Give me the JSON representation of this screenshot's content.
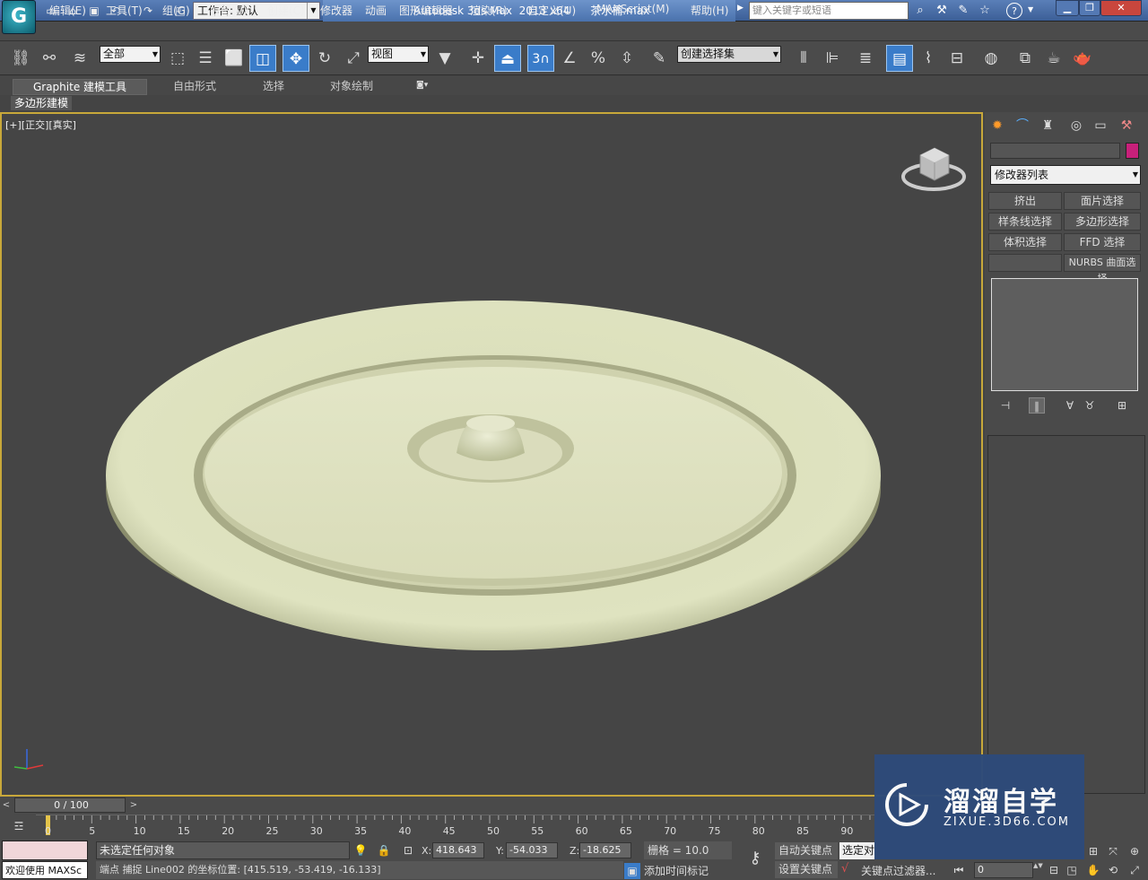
{
  "app": {
    "logo": "G",
    "title": "Autodesk 3ds Max  2013 x64      茶水桶.max",
    "workspace": "工作台: 默认",
    "search_placeholder": "键入关键字或短语"
  },
  "menu": [
    "编辑(E)",
    "工具(T)",
    "组(G)",
    "视图(V)",
    "创建(C)",
    "修改器",
    "动画",
    "图形编辑器",
    "渲染(R)",
    "自定义(U)",
    "MAXScript(M)",
    "帮助(H)"
  ],
  "toolbar": {
    "filter": "全部",
    "refcoord": "视图",
    "snap_value": "3",
    "selset": "创建选择集"
  },
  "ribbon": {
    "tabs": [
      "Graphite 建模工具",
      "自由形式",
      "选择",
      "对象绘制"
    ],
    "sub": "多边形建模"
  },
  "viewport": {
    "label": "[+][正交][真实]",
    "model": "lid"
  },
  "panel": {
    "tabs_icons": [
      "sun-icon",
      "curve-icon",
      "hierarchy-icon",
      "motion-icon",
      "display-icon",
      "hammer-icon"
    ],
    "swatch_color": "#c8207a",
    "modlist": "修改器列表",
    "buttons": [
      "挤出",
      "面片选择",
      "样条线选择",
      "多边形选择",
      "体积选择",
      "FFD 选择",
      "",
      "NURBS 曲面选择"
    ]
  },
  "timeline": {
    "counter": "0 / 100",
    "ticks": [
      "0",
      "5",
      "10",
      "15",
      "20",
      "25",
      "30",
      "35",
      "40",
      "45",
      "50",
      "55",
      "60",
      "65",
      "70",
      "75",
      "80",
      "85",
      "90"
    ]
  },
  "status": {
    "maxscript": "欢迎使用  MAXSc",
    "selection": "未选定任何对象",
    "x_label": "X:",
    "x": "418.643",
    "y_label": "Y:",
    "y": "-54.033",
    "z_label": "Z:",
    "z": "-18.625",
    "grid": "栅格 = 10.0",
    "prompt": "端点 捕捉 Line002 的坐标位置:  [415.519, -53.419, -16.133]",
    "auto_key": "自动关键点",
    "set_key": "设置关键点",
    "selected": "选定对",
    "add_time_tag": "添加时间标记",
    "key_filter": "关键点过滤器...",
    "frame": "0"
  },
  "watermark": {
    "brand": "溜溜自学",
    "url": "ZIXUE.3D66.COM"
  }
}
